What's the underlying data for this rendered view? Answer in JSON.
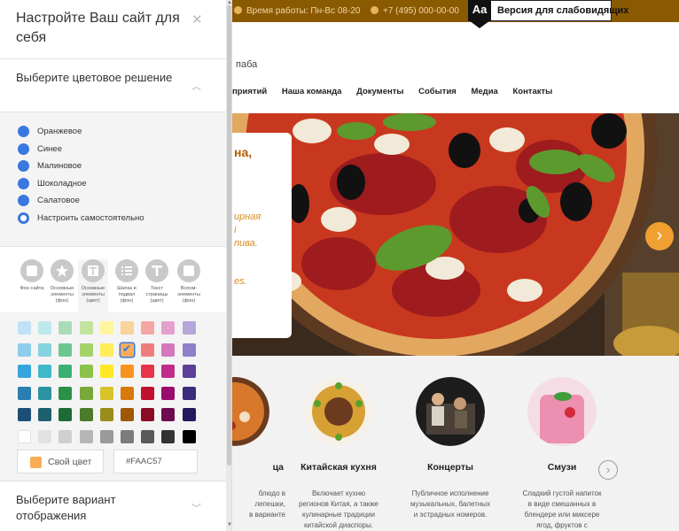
{
  "site": {
    "topbar": {
      "hours": "Время работы: Пн-Вс 08-20",
      "phone": "+7 (495) 000-00-00"
    },
    "a11y": {
      "icon_text": "Aa",
      "label": "Версия для слабовидящих"
    },
    "brand_fragment": "паба",
    "nav": [
      "приятий",
      "Наша команда",
      "Документы",
      "События",
      "Медиа",
      "Контакты"
    ],
    "hero": {
      "title_fragment": "на,",
      "text_fragment_1": "ирная",
      "text_fragment_2": "і",
      "text_fragment_3": "пива.",
      "text_fragment_4": "es."
    },
    "cards": [
      {
        "title": "ца",
        "desc": "блюдо в\nлепешки,\nв варианте"
      },
      {
        "title": "Китайская кухня",
        "desc": "Включает кухню\nрегионов Китая, а также\nкулинарные традиции\nкитайской диаспоры."
      },
      {
        "title": "Концерты",
        "desc": "Публичное исполнение\nмузыкальных, балетных\nи эстрадных номеров."
      },
      {
        "title": "Смузи",
        "desc": "Сладкий густой напиток\nв виде смешанных в\nблендере или миксере\nягод, фруктов с"
      }
    ]
  },
  "panel": {
    "title": "Настройте Ваш сайт для себя",
    "color_section_title": "Выберите цветовое решение",
    "color_options": [
      "Оранжевое",
      "Синее",
      "Малиновое",
      "Шоколадное",
      "Салатовое",
      "Настроить самостоятельно"
    ],
    "selected_option": "Настроить самостоятельно",
    "tabs": [
      {
        "label": "Фон сайта",
        "icon": "square-icon"
      },
      {
        "label": "Основные элементы (фон)",
        "icon": "star-icon"
      },
      {
        "label": "Основные элементы (цвет)",
        "icon": "text-block-icon"
      },
      {
        "label": "Шапка и подвал (фон)",
        "icon": "list-icon"
      },
      {
        "label": "Текст страницы (цвет)",
        "icon": "text-icon"
      },
      {
        "label": "Вспом-элементы (фон)",
        "icon": "square-icon"
      }
    ],
    "active_tab": "Основные элементы (цвет)",
    "palette": [
      [
        "#bfe3f5",
        "#bde8ec",
        "#a9dcb6",
        "#c3e39e",
        "#fff59d",
        "#fad29b",
        "#f6a5a5",
        "#e6a0d0",
        "#b5a7d9"
      ],
      [
        "#8ccdec",
        "#86d3df",
        "#6cc78e",
        "#a5d36a",
        "#ffee58",
        "#faac57",
        "#f07d7d",
        "#d477bd",
        "#8f7fc9"
      ],
      [
        "#35a6dd",
        "#3fb8c9",
        "#3bb070",
        "#8bc34a",
        "#ffe824",
        "#f7941d",
        "#e8344a",
        "#c02c8c",
        "#5b3f99"
      ],
      [
        "#2a7fb0",
        "#2c93a3",
        "#2a9148",
        "#79a83a",
        "#d7c32a",
        "#d9780f",
        "#c0102e",
        "#990d6f",
        "#3d2c7c"
      ],
      [
        "#1c4f78",
        "#1d5f6c",
        "#1e6a34",
        "#4c7a28",
        "#9a8d1a",
        "#9e5808",
        "#8b0c22",
        "#6e0a52",
        "#221a5c"
      ],
      [
        "#ffffff",
        "#e2e2e2",
        "#cfcfcf",
        "#b6b6b6",
        "#9a9a9a",
        "#7c7c7c",
        "#5a5a5a",
        "#333333",
        "#000000"
      ]
    ],
    "selected_color": "#faac57",
    "own_color_label": "Свой цвет",
    "hex_value": "#FAAC57",
    "display_section_title": "Выберите вариант отображения"
  }
}
